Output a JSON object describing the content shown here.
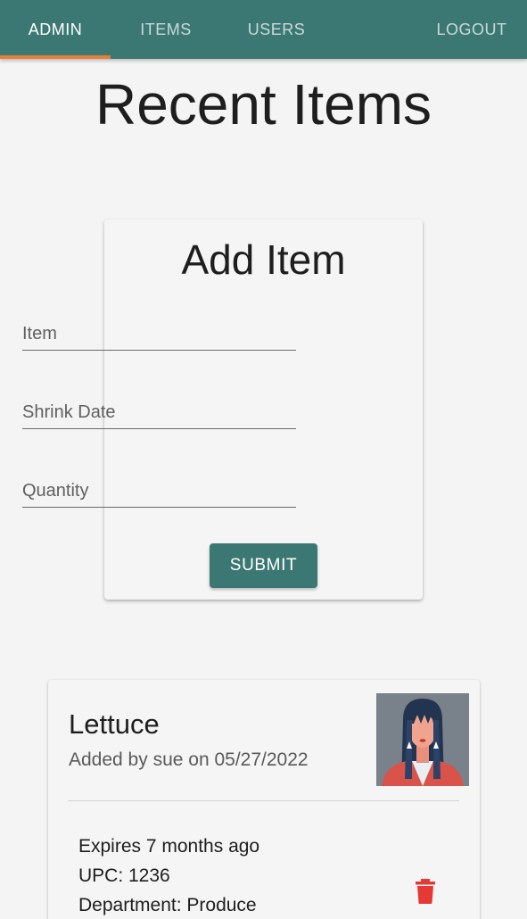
{
  "nav": {
    "tabs": [
      {
        "label": "ADMIN",
        "active": true
      },
      {
        "label": "ITEMS",
        "active": false
      },
      {
        "label": "USERS",
        "active": false
      }
    ],
    "logout_label": "LOGOUT"
  },
  "page": {
    "title": "Recent Items"
  },
  "add_item": {
    "title": "Add Item",
    "fields": {
      "item": {
        "placeholder": "Item",
        "value": ""
      },
      "shrink_date": {
        "placeholder": "Shrink Date",
        "value": ""
      },
      "quantity": {
        "placeholder": "Quantity",
        "value": ""
      }
    },
    "submit_label": "SUBMIT"
  },
  "items": [
    {
      "name": "Lettuce",
      "subtitle": "Added by sue on 05/27/2022",
      "expires": "Expires 7 months ago",
      "upc": "UPC: 1236",
      "department": "Department: Produce",
      "avatar_icon": "user-avatar-woman"
    }
  ],
  "colors": {
    "primary": "#3c7873",
    "indicator": "#e57f3a",
    "delete": "#e53935"
  }
}
